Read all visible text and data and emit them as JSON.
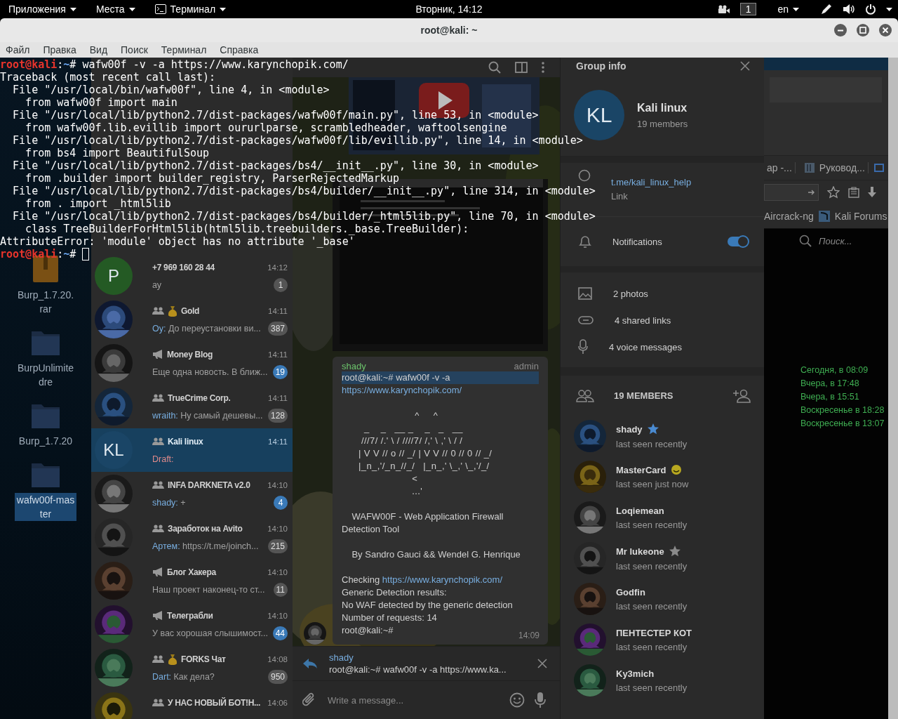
{
  "top_panel": {
    "menus": [
      {
        "label": "Приложения",
        "kind": "menu"
      },
      {
        "label": "Места",
        "kind": "menu"
      },
      {
        "label": "Терминал",
        "kind": "app"
      }
    ],
    "clock": "Вторник, 14:12",
    "workspace": "1",
    "language": "en"
  },
  "window": {
    "title": "root@kali: ~",
    "menu": [
      "Файл",
      "Правка",
      "Вид",
      "Поиск",
      "Терминал",
      "Справка"
    ]
  },
  "terminal": {
    "lines": [
      {
        "kind": "prompt",
        "host": "root@kali",
        "colon": ":",
        "path": "~",
        "symbol": "#",
        "command": "wafw00f -v -a https://www.karynchopik.com/"
      },
      {
        "kind": "output",
        "text": "Traceback (most recent call last):"
      },
      {
        "kind": "output",
        "text": "  File \"/usr/local/bin/wafw00f\", line 4, in <module>"
      },
      {
        "kind": "output",
        "text": "    from wafw00f import main"
      },
      {
        "kind": "output",
        "text": "  File \"/usr/local/lib/python2.7/dist-packages/wafw00f/main.py\", line 53, in <module>"
      },
      {
        "kind": "output",
        "text": "    from wafw00f.lib.evillib import oururlparse, scrambledheader, waftoolsengine"
      },
      {
        "kind": "output",
        "text": "  File \"/usr/local/lib/python2.7/dist-packages/wafw00f/lib/evillib.py\", line 14, in <module>"
      },
      {
        "kind": "output",
        "text": "    from bs4 import BeautifulSoup"
      },
      {
        "kind": "output",
        "text": "  File \"/usr/local/lib/python2.7/dist-packages/bs4/__init__.py\", line 30, in <module>"
      },
      {
        "kind": "output",
        "text": "    from .builder import builder_registry, ParserRejectedMarkup"
      },
      {
        "kind": "output",
        "text": "  File \"/usr/local/lib/python2.7/dist-packages/bs4/builder/__init__.py\", line 314, in <module>"
      },
      {
        "kind": "output",
        "text": "    from . import _html5lib"
      },
      {
        "kind": "output",
        "text": "  File \"/usr/local/lib/python2.7/dist-packages/bs4/builder/_html5lib.py\", line 70, in <module>"
      },
      {
        "kind": "output",
        "text": "    class TreeBuilderForHtml5lib(html5lib.treebuilders._base.TreeBuilder):"
      },
      {
        "kind": "output",
        "text": "AttributeError: 'module' object has no attribute '_base'"
      },
      {
        "kind": "prompt",
        "host": "root@kali",
        "colon": ":",
        "path": "~",
        "symbol": "#",
        "cursor": true
      }
    ]
  },
  "desktop": {
    "icons": [
      {
        "label": "Burp_1.7.20.rar",
        "kind": "archive",
        "selected": false
      },
      {
        "label": "BurpUnlimitedre",
        "kind": "folder",
        "selected": false
      },
      {
        "label": "Burp_1.7.20",
        "kind": "folder",
        "selected": false
      },
      {
        "label": "wafw00f-master",
        "kind": "folder",
        "selected": true
      }
    ]
  },
  "telegram": {
    "chats": [
      {
        "kind": "contact",
        "avatar": {
          "kind": "initials",
          "text": "P",
          "color": "#245a24"
        },
        "name": "+7 969 160 28 44",
        "time": "14:12",
        "preview": "ау",
        "unread": "1",
        "muted": true,
        "selected": false
      },
      {
        "kind": "group",
        "name": "Gold",
        "emoji": true,
        "time": "14:11",
        "sender": "Оу:",
        "preview": "До переустановки ви...",
        "unread": "387",
        "muted": true,
        "selected": false
      },
      {
        "kind": "channel",
        "name": "Money Blog",
        "time": "14:11",
        "preview": "Еще одна новость. В ближ...",
        "unread": "19",
        "muted": false,
        "selected": false
      },
      {
        "kind": "group",
        "name": "TrueCrime Corp.",
        "time": "14:11",
        "sender": "wraith:",
        "preview": "Ну самый дешевы...",
        "unread": "128",
        "muted": true,
        "selected": false
      },
      {
        "kind": "group",
        "avatar": {
          "kind": "initials",
          "text": "KL",
          "color": "#1a4566"
        },
        "name": "Kali linux",
        "time": "14:11",
        "sender": "Draft:",
        "draft": true,
        "selected": true
      },
      {
        "kind": "group",
        "name": "INFA DARKNETA v2.0",
        "time": "14:10",
        "sender": "shady:",
        "preview": "+",
        "unread": "4",
        "muted": false,
        "selected": false
      },
      {
        "kind": "group",
        "name": "Заработок на Avito",
        "time": "14:10",
        "sender": "Артем:",
        "preview": "https://t.me/joinch...",
        "unread": "215",
        "muted": true,
        "selected": false
      },
      {
        "kind": "channel",
        "name": "Блог Хакера",
        "time": "14:10",
        "preview": "Наш проект наконец-то ст...",
        "unread": "11",
        "muted": true,
        "selected": false
      },
      {
        "kind": "channel",
        "name": "Телеграбли",
        "time": "14:10",
        "preview": "У вас хорошая слышимост...",
        "unread": "44",
        "muted": false,
        "selected": false
      },
      {
        "kind": "group",
        "name": "FORKS Чат",
        "emoji": true,
        "time": "14:08",
        "sender": "Dart:",
        "preview": "Как дела?",
        "unread": "950",
        "muted": true,
        "selected": false
      },
      {
        "kind": "group",
        "name": "У НАС НОВЫЙ БОТ!Н...",
        "time": "14:06",
        "selected": false
      }
    ],
    "conversation": {
      "message": {
        "sender": "shady",
        "role": "admin",
        "time": "14:09",
        "paragraphs": [
          {
            "kind": "text",
            "lines": [
              {
                "text": "root@kali:~# wafw00f -v -a",
                "highlighted": true
              },
              {
                "link": "https://www.karynchopik.com/"
              }
            ]
          },
          {
            "kind": "art",
            "lines": [
              {
                "text": "                          ^     ^"
              },
              {
                "text": "        _    _   __ _    _   _   __"
              },
              {
                "text": "       ///7/ /.' \\ / ////7/ /,' \\ ,' \\ / /"
              },
              {
                "text": "      | V V // o // _/ | V V // 0 // 0 // _/"
              },
              {
                "text": "      |_n_,'/_n_//_/   |_n_,' \\_,' \\_,'/_/"
              },
              {
                "text": "                         <"
              },
              {
                "text": "                         ...'"
              }
            ]
          },
          {
            "kind": "text",
            "lines": [
              {
                "text": "    WAFW00F - Web Application Firewall Detection Tool"
              }
            ]
          },
          {
            "kind": "text",
            "lines": [
              {
                "text": "    By Sandro Gauci && Wendel G. Henrique"
              }
            ]
          },
          {
            "kind": "text",
            "lines": [
              {
                "text": "Checking ",
                "link": "https://www.karynchopik.com/"
              },
              {
                "text": "Generic Detection results:"
              },
              {
                "text": "No WAF detected by the generic detection"
              },
              {
                "text": "Number of requests: 14"
              },
              {
                "text": "root@kali:~#"
              }
            ]
          }
        ]
      },
      "reply": {
        "sender": "shady",
        "text": "root@kali:~# wafw00f -v -a https://www.ka..."
      },
      "composer": {
        "placeholder": "Write a message..."
      }
    },
    "group_info": {
      "title": "Group info",
      "avatar": {
        "kind": "initials",
        "text": "KL",
        "color": "#1a4566"
      },
      "name": "Kali linux",
      "subtitle": "19 members",
      "link": "t.me/kali_linux_help",
      "link_label": "Link",
      "notifications": {
        "label": "Notifications",
        "on": true
      },
      "media": [
        {
          "kind": "photos",
          "label": "2 photos"
        },
        {
          "kind": "links",
          "label": "4 shared links"
        },
        {
          "kind": "voice",
          "label": "4 voice messages"
        }
      ],
      "members_title": "19 MEMBERS",
      "members": [
        {
          "name": "shady",
          "status": "last seen recently",
          "kind": "creator"
        },
        {
          "name": "MasterCard",
          "emoji": true,
          "status": "last seen just now",
          "kind": "member"
        },
        {
          "name": "Loqiemean",
          "status": "last seen recently",
          "kind": "member"
        },
        {
          "name": "Mr lukeone",
          "status": "last seen recently",
          "kind": "admin"
        },
        {
          "name": "Godfin",
          "status": "last seen recently",
          "kind": "member"
        },
        {
          "name": "ПЕНТЕСТЕР КОТ",
          "status": "last seen recently",
          "kind": "member"
        },
        {
          "name": "Ky3mich",
          "status": "last seen recently",
          "kind": "member"
        }
      ]
    }
  },
  "browser": {
    "tabs": [
      "ар -...",
      "Руковод..."
    ],
    "bookmarks": [
      "Aircrack-ng",
      "Kali Forums"
    ],
    "search_placeholder": "Поиск...",
    "dates": [
      "Сегодня, в 08:09",
      "Вчера, в 17:48",
      "Вчера, в 15:51",
      "Воскресенье в 18:28",
      "Воскресенье в 13:07"
    ]
  }
}
